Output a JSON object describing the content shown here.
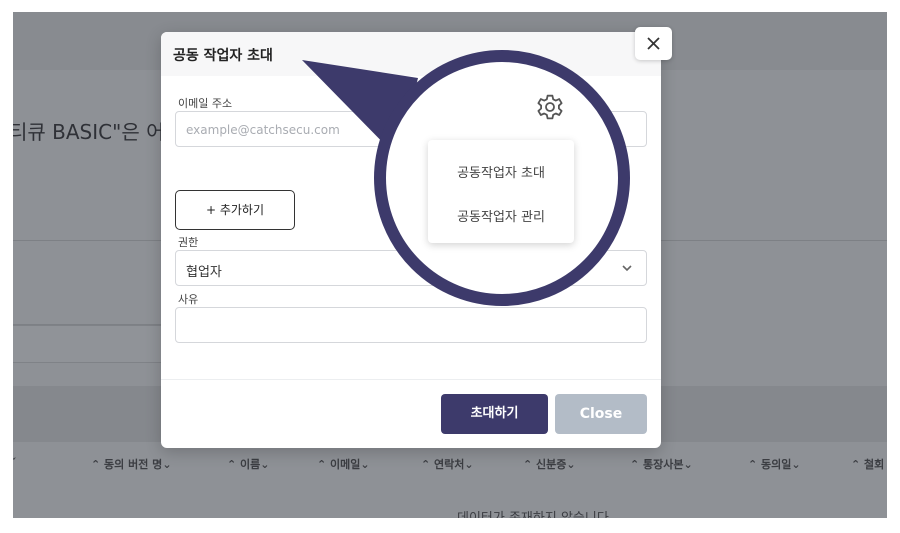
{
  "background": {
    "page_title_fragment": "티큐 BASIC\"은 어",
    "table_headers": [
      "ˇ",
      "동의 버전 명",
      "이름",
      "이메일",
      "연락처",
      "신분증",
      "통장사본",
      "동의일",
      "철회"
    ],
    "empty_message": "데이터가 존재하지 않습니다"
  },
  "modal": {
    "title": "공동 작업자 초대",
    "email_label": "이메일 주소",
    "email_placeholder": "example@catchsecu.com",
    "add_button": "+ 추가하기",
    "role_label": "권한",
    "role_value": "협업자",
    "reason_label": "사유",
    "invite_button": "초대하기",
    "close_button": "Close"
  },
  "magnifier": {
    "icon": "gear-icon",
    "menu_items": [
      "공동작업자 초대",
      "공동작업자 관리"
    ]
  },
  "colors": {
    "primary": "#3d3a6b",
    "close_disabled": "#b3bcc7",
    "overlay": "#8e9196"
  }
}
